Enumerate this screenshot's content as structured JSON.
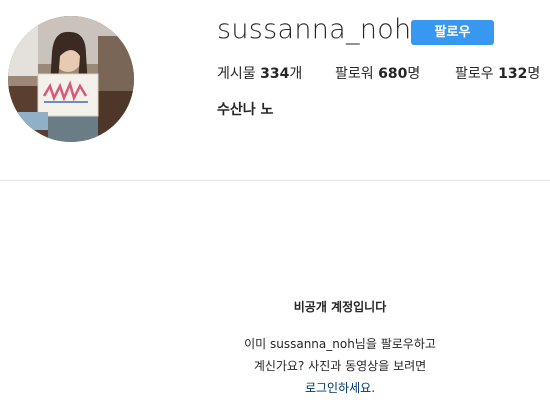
{
  "profile": {
    "username": "sussanna_noh",
    "follow_label": "팔로우",
    "full_name": "수산나 노",
    "stats": {
      "posts_label": "게시물",
      "posts_count": "334",
      "posts_suffix": "개",
      "followers_label": "팔로워",
      "followers_count": "680",
      "followers_suffix": "명",
      "following_label": "팔로우",
      "following_count": "132",
      "following_suffix": "명"
    }
  },
  "private_account": {
    "title": "비공개 계정입니다",
    "line1": "이미 sussanna_noh님을 팔로우하고",
    "line2": "계신가요? 사진과 동영상을 보려면",
    "login_link": "로그인하세요",
    "login_suffix": "."
  },
  "colors": {
    "accent": "#3897f0",
    "link": "#003569",
    "divider": "#e6e6e6"
  }
}
